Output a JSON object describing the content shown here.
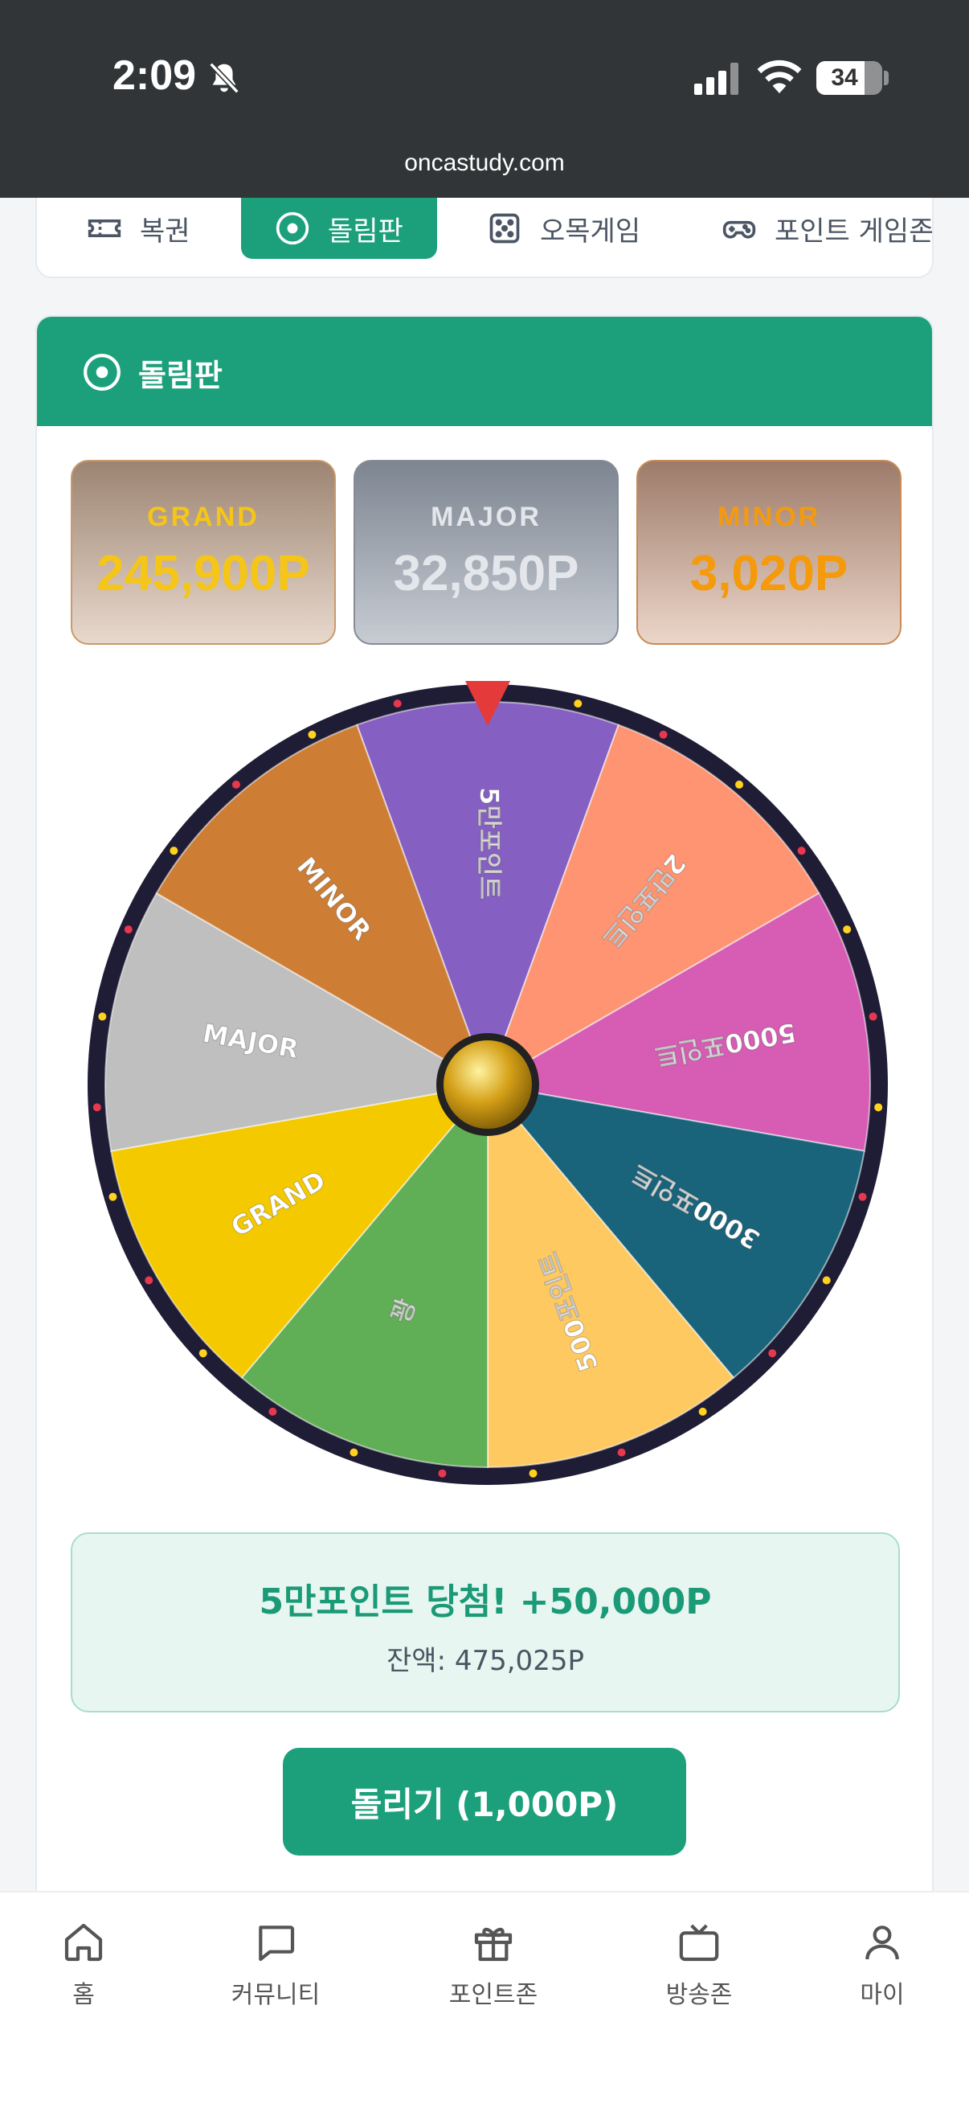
{
  "status_bar": {
    "time": "2:09",
    "battery": "34",
    "url": "oncastudy.com"
  },
  "tabs": [
    {
      "label": "복권",
      "icon": "ticket-icon",
      "active": false
    },
    {
      "label": "돌림판",
      "icon": "target-icon",
      "active": true
    },
    {
      "label": "오목게임",
      "icon": "dice-icon",
      "active": false
    },
    {
      "label": "포인트 게임존",
      "icon": "gamepad-icon",
      "active": false
    }
  ],
  "card": {
    "title": "돌림판"
  },
  "jackpots": [
    {
      "label": "GRAND",
      "value": "245,900P"
    },
    {
      "label": "MAJOR",
      "value": "32,850P"
    },
    {
      "label": "MINOR",
      "value": "3,020P"
    }
  ],
  "wheel": {
    "segments": [
      {
        "label": "5만포인트",
        "color": "#8560c2"
      },
      {
        "label": "2만포인트",
        "color": "#fe9471"
      },
      {
        "label": "5000포인트",
        "color": "#d65cb4"
      },
      {
        "label": "3000포인트",
        "color": "#19647b"
      },
      {
        "label": "500포인트",
        "color": "#fec961"
      },
      {
        "label": "꽝",
        "color": "#60ae55"
      },
      {
        "label": "GRAND",
        "color": "#f4c900"
      },
      {
        "label": "MAJOR",
        "color": "#bfbfbf"
      },
      {
        "label": "MINOR",
        "color": "#cd7e34"
      }
    ],
    "pointer_color": "#e53a3a",
    "rim_color": "#1f1c35",
    "hub_color": "#d4a017"
  },
  "result": {
    "message": "5만포인트 당첨! +50,000P",
    "balance": "잔액: 475,025P"
  },
  "spin_button": {
    "label": "돌리기 (1,000P)"
  },
  "bottom_nav": [
    {
      "label": "홈",
      "icon": "home-icon"
    },
    {
      "label": "커뮤니티",
      "icon": "chat-icon"
    },
    {
      "label": "포인트존",
      "icon": "gift-icon"
    },
    {
      "label": "방송존",
      "icon": "tv-icon"
    },
    {
      "label": "마이",
      "icon": "user-icon"
    }
  ]
}
